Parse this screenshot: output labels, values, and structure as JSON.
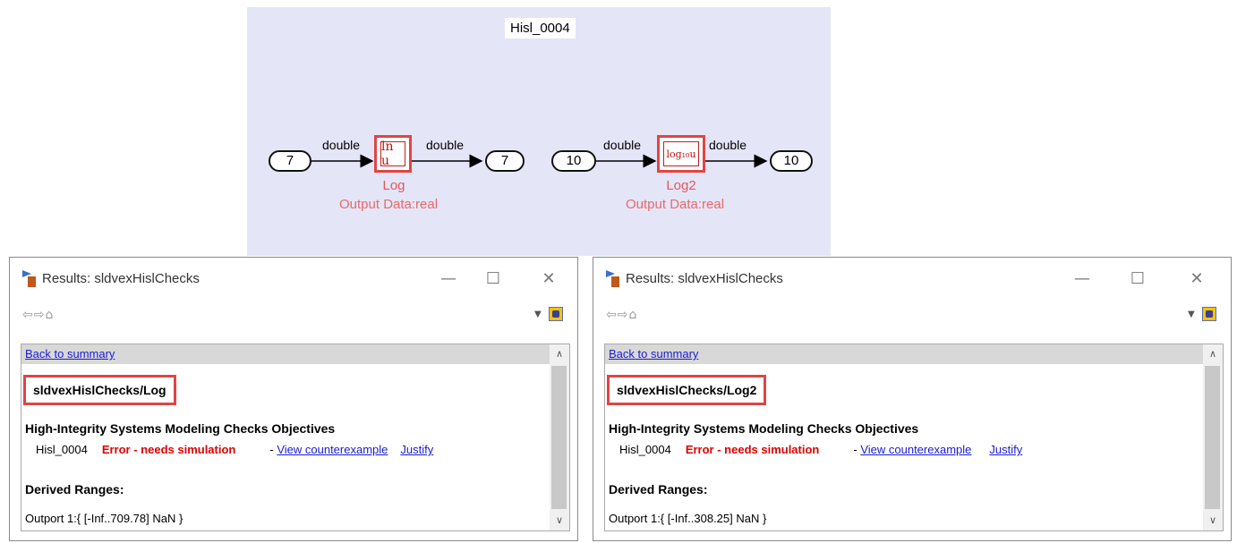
{
  "diagram": {
    "title": "Hisl_0004",
    "signal_type": "double",
    "group1": {
      "inport": "7",
      "block_symbol": "ln u",
      "block_name": "Log",
      "block_note": "Output Data:real",
      "outport": "7"
    },
    "group2": {
      "inport": "10",
      "block_symbol": "log₁₀u",
      "block_name": "Log2",
      "block_note": "Output Data:real",
      "outport": "10"
    }
  },
  "windows": [
    {
      "title": "Results: sldvexHislChecks",
      "controls": {
        "minimize": "—",
        "maximize": "☐",
        "close": "✕"
      },
      "nav_icons": "⇦⇨⌂",
      "back_link": "Back to summary",
      "path": "sldvexHislChecks/Log",
      "objectives_heading": "High-Integrity Systems Modeling Checks Objectives",
      "objective": {
        "id": "Hisl_0004",
        "status": "Error - needs simulation",
        "separator": "- ",
        "counterexample_link": "View counterexample",
        "justify_link": "Justify"
      },
      "ranges_heading": "Derived Ranges:",
      "range": "Outport 1:{ [-Inf..709.78] NaN }"
    },
    {
      "title": "Results: sldvexHislChecks",
      "controls": {
        "minimize": "—",
        "maximize": "☐",
        "close": "✕"
      },
      "nav_icons": "⇦⇨⌂",
      "back_link": "Back to summary",
      "path": "sldvexHislChecks/Log2",
      "objectives_heading": "High-Integrity Systems Modeling Checks Objectives",
      "objective": {
        "id": "Hisl_0004",
        "status": "Error - needs simulation",
        "separator": "- ",
        "counterexample_link": "View counterexample",
        "justify_link": "Justify"
      },
      "ranges_heading": "Derived Ranges:",
      "range": "Outport 1:{ [-Inf..308.25] NaN }"
    }
  ],
  "colors": {
    "canvas": "#e5e5f8",
    "highlight": "#e04545",
    "error": "#e00000",
    "link": "#1a1ad6"
  }
}
